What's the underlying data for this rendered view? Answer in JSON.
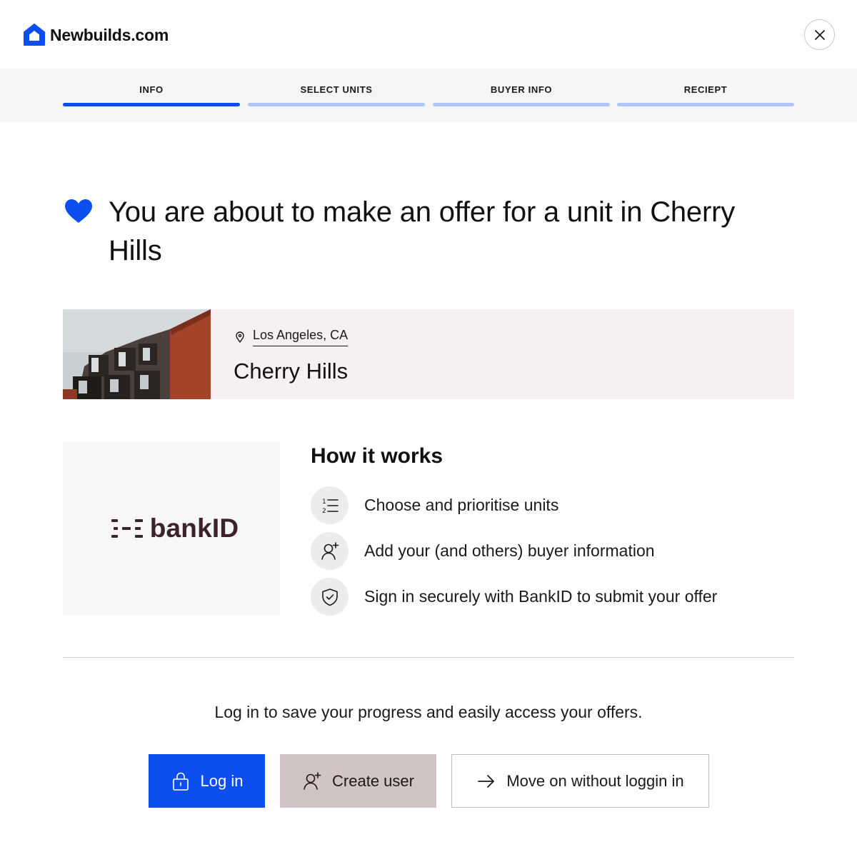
{
  "header": {
    "brand": "Newbuilds.com",
    "logo_icon": "house-icon",
    "close_icon": "close-icon"
  },
  "steps": [
    {
      "label": "INFO",
      "active": true
    },
    {
      "label": "SELECT UNITS",
      "active": false
    },
    {
      "label": "BUYER INFO",
      "active": false
    },
    {
      "label": "RECIEPT",
      "active": false
    }
  ],
  "intro": {
    "icon": "heart-icon",
    "title": "You are about to make an offer for a unit in Cherry Hills"
  },
  "project": {
    "image": "apartment-building-photo",
    "location": "Los Angeles, CA",
    "name": "Cherry Hills"
  },
  "bankid": {
    "logo_text": "bankID"
  },
  "how_it_works": {
    "title": "How it works",
    "items": [
      {
        "icon": "numbered-list-icon",
        "text": "Choose and prioritise units"
      },
      {
        "icon": "add-user-icon",
        "text": "Add your (and others) buyer information"
      },
      {
        "icon": "shield-check-icon",
        "text": "Sign in securely with BankID to submit your offer"
      }
    ]
  },
  "login": {
    "prompt": "Log in to save your progress and easily access your offers.",
    "login_label": "Log in",
    "create_label": "Create user",
    "skip_label": "Move on without loggin in"
  },
  "colors": {
    "accent": "#0d4ef1",
    "step_inactive": "#b2c5fb",
    "card_bg": "#f6f1f0",
    "create_button": "#d2c4c4",
    "bankid_brand": "#3c2329"
  }
}
